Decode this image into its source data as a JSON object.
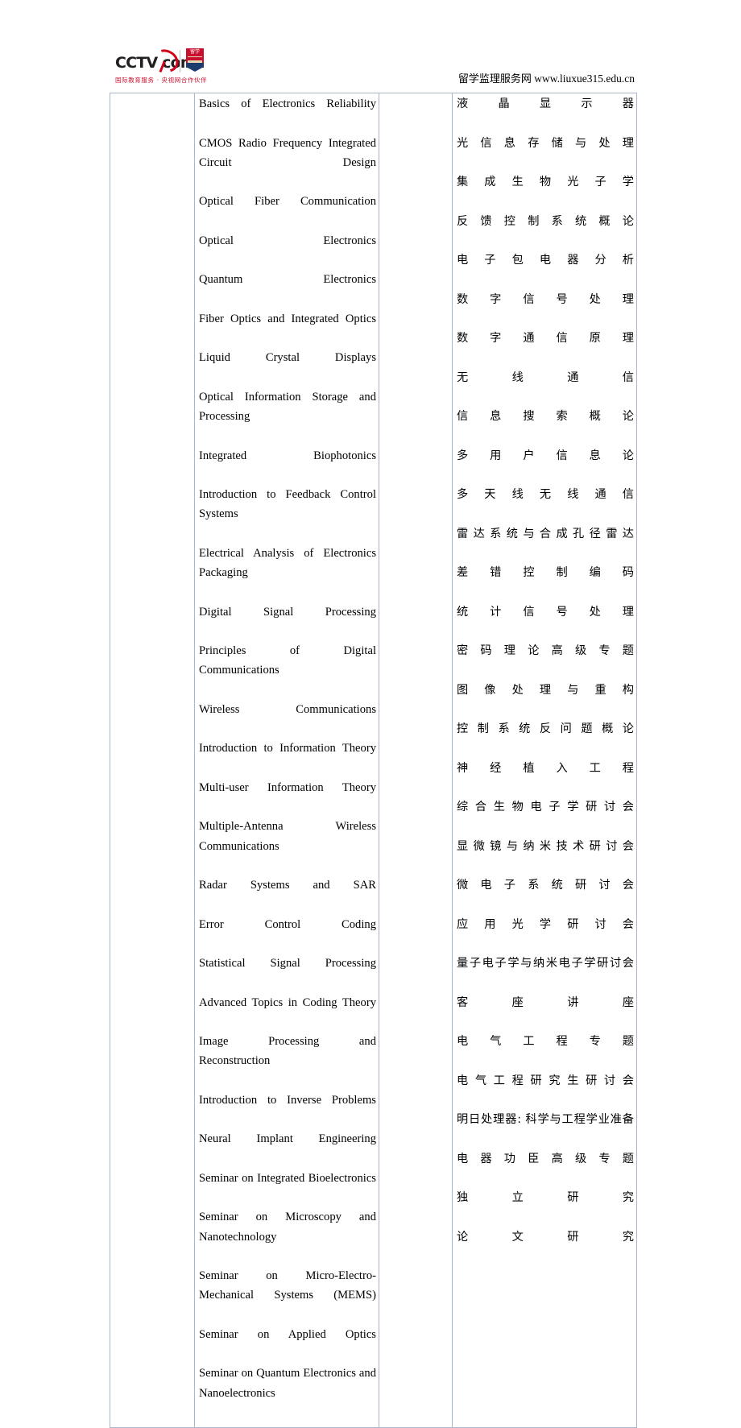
{
  "header": {
    "logo_wordmark": "CCTV com",
    "logo_tagline": "国际教育服务 · 央视网合作伙伴",
    "badge_label": "留学",
    "site_credit_cn": "留学监理服务网",
    "site_credit_url": "www.liuxue315.edu.cn",
    "brand_red": "#c8102e",
    "brand_dark": "#231f20"
  },
  "table": {
    "border_color": "#a9b7cc",
    "columns": [
      "",
      "english_courses",
      "",
      "chinese_courses"
    ],
    "english_courses": [
      "Basics of Electronics Reliability",
      "CMOS Radio Frequency Integrated Circuit Design",
      "Optical Fiber Communication",
      "Optical Electronics",
      "Quantum Electronics",
      "Fiber Optics and Integrated Optics",
      "Liquid Crystal Displays",
      "Optical Information Storage and Processing",
      "Integrated Biophotonics",
      "Introduction to Feedback Control Systems",
      "Electrical Analysis of Electronics Packaging",
      "Digital Signal Processing",
      "Principles of Digital Communications",
      "Wireless Communications",
      "Introduction to Information Theory",
      "Multi-user Information Theory",
      "Multiple-Antenna Wireless Communications",
      "Radar Systems and SAR",
      "Error Control Coding",
      "Statistical Signal Processing",
      "Advanced Topics in Coding Theory",
      "Image Processing and Reconstruction",
      "Introduction to Inverse Problems",
      "Neural Implant Engineering",
      "Seminar on Integrated Bioelectronics",
      "Seminar on Microscopy and Nanotechnology",
      "Seminar on Micro-Electro-Mechanical Systems (MEMS)",
      "Seminar on Applied Optics",
      "Seminar on Quantum Electronics and Nanoelectronics"
    ],
    "chinese_courses": [
      "液晶显示器",
      "光信息存储与处理",
      "集成生物光子学",
      "反馈控制系统概论",
      "电子包电器分析",
      "数字信号处理",
      "数字通信原理",
      "无线通信",
      "信息搜索概论",
      "多用户信息论",
      "多天线无线通信",
      "雷达系统与合成孔径雷达",
      "差错控制编码",
      "统计信号处理",
      "密码理论高级专题",
      "图像处理与重构",
      "控制系统反问题概论",
      "神经植入工程",
      "综合生物电子学研讨会",
      "显微镜与纳米技术研讨会",
      "微电子系统研讨会",
      "应用光学研讨会",
      "量子电子学与纳米电子学研讨会",
      "客座讲座",
      "电气工程专题",
      "电气工程研究生研讨会",
      "明日处理器: 科学与工程学业准备",
      "电器功臣高级专题",
      "独立研究",
      "论文研究"
    ]
  }
}
